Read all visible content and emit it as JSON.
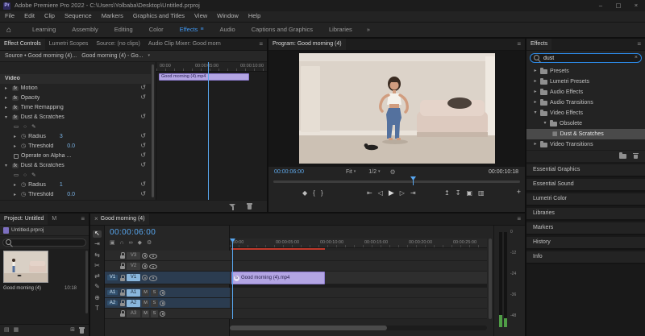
{
  "icons": {
    "app": "Pr",
    "home": "⌂",
    "panel_menu": "≡",
    "overflow": "»",
    "close": "×",
    "minimize": "–",
    "maximize": "▢",
    "chevron_right": "▸",
    "chevron_down": "▾",
    "dropdown": "▾",
    "reset": "↺",
    "stopwatch": "◷",
    "fx_badge": "fx",
    "mask_rect": "▭",
    "mask_ellipse": "○",
    "mask_pen": "✎",
    "marker": "◆",
    "mark_in": "{",
    "mark_out": "}",
    "goto_in": "⇤",
    "step_back": "◁",
    "play": "▶",
    "step_fwd": "▷",
    "goto_out": "⇥",
    "lift": "↥",
    "extract": "↧",
    "export_frame": "▣",
    "compare": "▥",
    "plus": "+",
    "settings": "⚙",
    "snap": "∩",
    "link": "∞",
    "nest": "▣",
    "tool_select": "↖",
    "tool_track_select": "⇥",
    "tool_ripple": "⇆",
    "tool_razor": "✂",
    "tool_slip": "⇄",
    "tool_pen": "✎",
    "tool_hand": "⊕",
    "tool_type": "T",
    "mute": "M",
    "solo": "S",
    "view_list": "▤",
    "view_icon": "▦",
    "new_item": "⊞"
  },
  "titlebar": {
    "title": "Adobe Premiere Pro 2022 - C:\\Users\\Yolbaba\\Desktop\\Untitled.prproj"
  },
  "menubar": {
    "items": [
      "File",
      "Edit",
      "Clip",
      "Sequence",
      "Markers",
      "Graphics and Titles",
      "View",
      "Window",
      "Help"
    ]
  },
  "workspaces": {
    "tabs": [
      "Learning",
      "Assembly",
      "Editing",
      "Color",
      "Effects",
      "Audio",
      "Captions and Graphics",
      "Libraries"
    ],
    "active_tab": "Effects"
  },
  "effect_controls": {
    "tabs": [
      "Effect Controls",
      "Lumetri Scopes",
      "Source: (no clips)",
      "Audio Clip Mixer: Good morn"
    ],
    "active_tab": "Effect Controls",
    "source_label": "Source • Good morning (4)...",
    "clip_menu_label": "Good morning (4) - Go...",
    "ruler_labels": [
      "00:00",
      "00:00:05:00",
      "00:00:10:00"
    ],
    "mini_clip_label": "Good morning (4).mp4",
    "video_section": "Video",
    "effect_motion": "Motion",
    "effect_opacity": "Opacity",
    "effect_time_remapping": "Time Remapping",
    "ds1": {
      "name": "Dust & Scratches",
      "radius_label": "Radius",
      "radius_value": "3",
      "threshold_label": "Threshold",
      "threshold_value": "0.0",
      "checkbox_label": "Operate on Alpha ..."
    },
    "ds2": {
      "name": "Dust & Scratches",
      "radius_label": "Radius",
      "radius_value": "1",
      "threshold_label": "Threshold",
      "threshold_value": "0.0"
    }
  },
  "program": {
    "tab": "Program: Good morning (4)",
    "timecode": "00:00:06:00",
    "fit": "Fit",
    "playback_resolution": "1/2",
    "duration": "00:00:10:18"
  },
  "project": {
    "tab": "Project: Untitled",
    "tab_overflow": "M",
    "file": "Untitled.prproj",
    "search_value": "",
    "clip_name": "Good morning (4)",
    "clip_duration": "10:18"
  },
  "timeline": {
    "tab": "Good morning (4)",
    "timecode": "00:00:06:00",
    "ruler_labels": [
      ":00:00",
      "00:00:05:00",
      "00:00:10:00",
      "00:00:15:00",
      "00:00:20:00",
      "00:00:25:00"
    ],
    "clip_label": "Good morning (4).mp4",
    "video_tracks": [
      {
        "patch": "",
        "name": "V3"
      },
      {
        "patch": "",
        "name": "V2"
      },
      {
        "patch": "V1",
        "name": "V1"
      }
    ],
    "audio_tracks": [
      {
        "patch": "A1",
        "name": "A1"
      },
      {
        "patch": "A2",
        "name": "A2"
      },
      {
        "patch": "",
        "name": "A3"
      }
    ],
    "meter_labels": [
      "0",
      "-12",
      "-24",
      "-36",
      "-48"
    ]
  },
  "effects_panel": {
    "tab": "Effects",
    "search_value": "dust",
    "tree": [
      {
        "label": "Presets"
      },
      {
        "label": "Lumetri Presets"
      },
      {
        "label": "Audio Effects"
      },
      {
        "label": "Audio Transitions"
      },
      {
        "label": "Video Effects"
      },
      {
        "label": "Obsolete"
      },
      {
        "label": "Dust & Scratches"
      },
      {
        "label": "Video Transitions"
      }
    ],
    "stack": [
      "Essential Graphics",
      "Essential Sound",
      "Lumetri Color",
      "Libraries",
      "Markers",
      "History",
      "Info"
    ]
  }
}
